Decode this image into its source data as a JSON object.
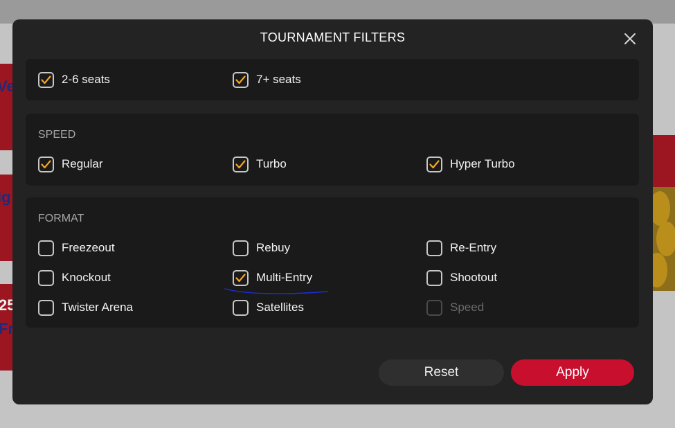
{
  "modal": {
    "title": "TOURNAMENT FILTERS",
    "close_icon": "close-icon"
  },
  "seats": {
    "options": [
      {
        "label": "2-6 seats",
        "checked": true
      },
      {
        "label": "7+ seats",
        "checked": true
      }
    ]
  },
  "speed": {
    "label": "SPEED",
    "options": [
      {
        "label": "Regular",
        "checked": true
      },
      {
        "label": "Turbo",
        "checked": true
      },
      {
        "label": "Hyper Turbo",
        "checked": true
      }
    ]
  },
  "format": {
    "label": "FORMAT",
    "options": [
      {
        "label": "Freezeout",
        "checked": false
      },
      {
        "label": "Rebuy",
        "checked": false
      },
      {
        "label": "Re-Entry",
        "checked": false
      },
      {
        "label": "Knockout",
        "checked": false
      },
      {
        "label": "Multi-Entry",
        "checked": true
      },
      {
        "label": "Shootout",
        "checked": false
      },
      {
        "label": "Twister Arena",
        "checked": false
      },
      {
        "label": "Satellites",
        "checked": false
      },
      {
        "label": "Speed",
        "checked": false,
        "disabled": true
      }
    ]
  },
  "buttons": {
    "reset": "Reset",
    "apply": "Apply"
  },
  "background": {
    "fragments": [
      "Ve",
      "ig",
      "25",
      "Fr"
    ]
  },
  "colors": {
    "accent": "#c8102e",
    "check": "#f5a623",
    "modal_bg": "#232323",
    "panel_bg": "#1a1a1a",
    "annotation": "#1e2fd6"
  }
}
